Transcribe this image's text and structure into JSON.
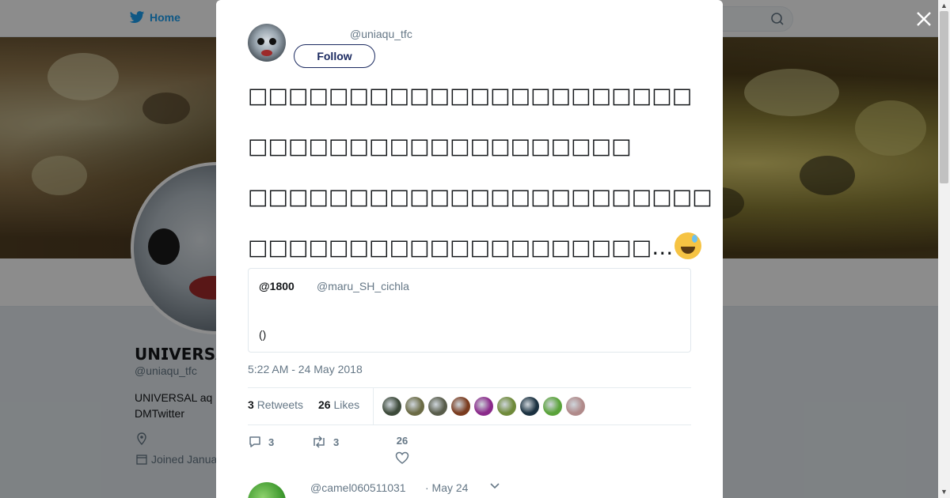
{
  "nav": {
    "home_label": "Home"
  },
  "profile": {
    "name": "𝗨𝗡𝗜𝗩𝗘𝗥𝗦𝗔𝗟𝗔𝗤𝗨",
    "handle": "@uniaqu_tfc",
    "bio": "UNIVERSAL aq DMTwitter",
    "joined": "Joined Janua"
  },
  "modal": {
    "author_handle": "@uniaqu_tfc",
    "follow_label": "Follow",
    "tweet_lines": [
      "□□□□□□□□□□□□□□□□□□□□□□",
      "□□□□□□□□□□□□□□□□□□□",
      "□□□□□□□□□□□□□□□□□□□□□□□",
      "□□□□□□□□□□□□□□□□□□□□…"
    ],
    "emoji": "sweat-smile-emoji",
    "quote": {
      "name": "@1800",
      "handle": "@maru_SH_cichla",
      "text": "()"
    },
    "timestamp": "5:22 AM - 24 May 2018",
    "retweets_count": "3",
    "retweets_label": "Retweets",
    "likes_count": "26",
    "likes_label": "Likes",
    "likers": [
      "#3d4a3a",
      "#6b6b45",
      "#585c4a",
      "#7a3b1e",
      "#8a2a8a",
      "#6f8a3a",
      "#1b3140",
      "#5aa33a",
      "#b08a8a"
    ],
    "reply_count": "3",
    "retweet_action_count": "3",
    "like_action_count": "26",
    "reply": {
      "handle": "@camel060511031",
      "date": "· May 24"
    }
  },
  "colors": {
    "accent": "#1da1f2",
    "follow": "#1b2a60",
    "muted": "#657786"
  }
}
